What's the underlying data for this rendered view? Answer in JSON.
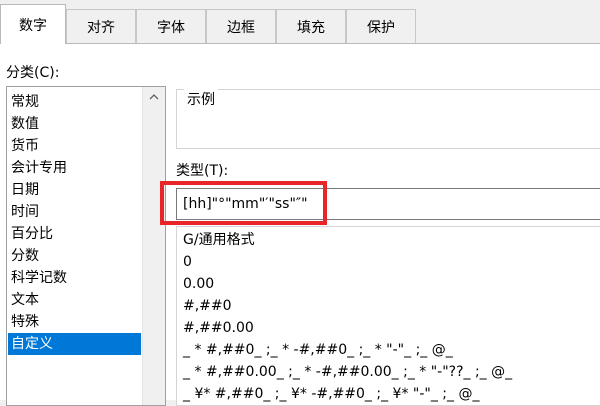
{
  "tabs": [
    {
      "label": "数字",
      "active": true
    },
    {
      "label": "对齐",
      "active": false
    },
    {
      "label": "字体",
      "active": false
    },
    {
      "label": "边框",
      "active": false
    },
    {
      "label": "填充",
      "active": false
    },
    {
      "label": "保护",
      "active": false
    }
  ],
  "category": {
    "label": "分类(C):",
    "items": [
      "常规",
      "数值",
      "货币",
      "会计专用",
      "日期",
      "时间",
      "百分比",
      "分数",
      "科学记数",
      "文本",
      "特殊",
      "自定义"
    ],
    "selected": "自定义"
  },
  "sample": {
    "label": "示例"
  },
  "type": {
    "label": "类型(T):",
    "value": "[hh]\"°\"mm\"′\"ss\"″\""
  },
  "formats": [
    "G/通用格式",
    "0",
    "0.00",
    "#,##0",
    "#,##0.00",
    "_ * #,##0_ ;_ * -#,##0_ ;_ * \"-\"_ ;_ @_",
    "_ * #,##0.00_ ;_ * -#,##0.00_ ;_ * \"-\"??_ ;_ @_",
    "_ ¥* #,##0_ ;_ ¥* -#,##0_ ;_ ¥* \"-\"_ ;_ @_"
  ],
  "colors": {
    "selection": "#0078d7",
    "highlight_box": "#e8262a"
  },
  "icons": {
    "scroll_up": "chevron-up-icon"
  }
}
